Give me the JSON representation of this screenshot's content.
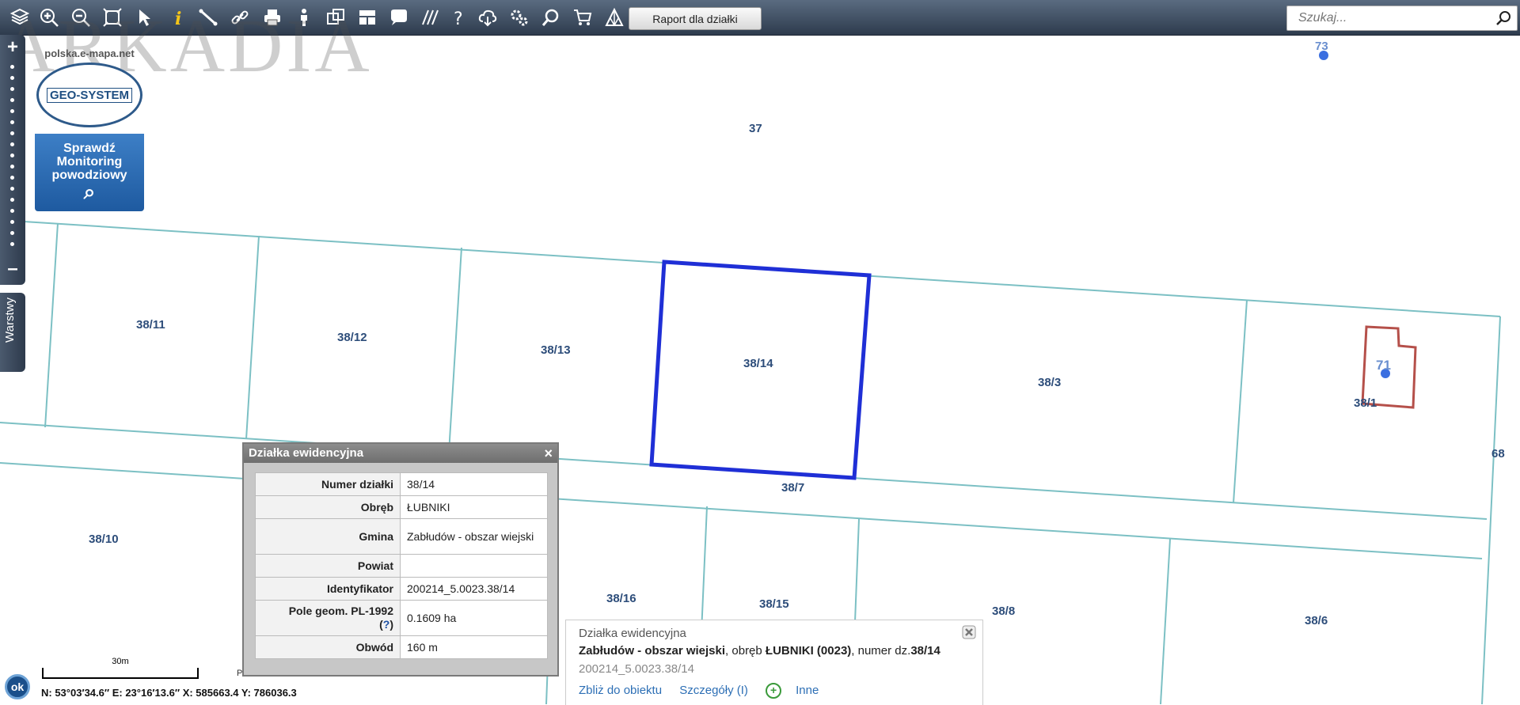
{
  "toolbar": {
    "report_button": "Raport dla działki",
    "search_placeholder": "Szukaj..."
  },
  "watermark": "ARKADIA",
  "logo": {
    "url": "polska.e-mapa.net",
    "brand": "GEO-SYSTEM",
    "line1": "Sprawdź",
    "line2": "Monitoring",
    "line3": "powodziowy"
  },
  "sidebar": {
    "layers_tab": "Warstwy"
  },
  "map_labels": {
    "p37": "37",
    "p73": "73",
    "p71": "71",
    "p68": "68",
    "p38_11": "38/11",
    "p38_12": "38/12",
    "p38_13": "38/13",
    "p38_14": "38/14",
    "p38_3": "38/3",
    "p38_1": "38/1",
    "p38_7": "38/7",
    "p38_10": "38/10",
    "p38_16": "38/16",
    "p38_15": "38/15",
    "p38_8": "38/8",
    "p38_6": "38/6"
  },
  "parcel_popup": {
    "title": "Działka ewidencyjna",
    "rows": [
      {
        "key": "Numer działki",
        "value": "38/14"
      },
      {
        "key": "Obręb",
        "value": "ŁUBNIKI"
      },
      {
        "key": "Gmina",
        "value": "Zabłudów - obszar wiejski"
      },
      {
        "key": "Powiat",
        "value": ""
      },
      {
        "key": "Identyfikator",
        "value": "200214_5.0023.38/14"
      },
      {
        "key": "Pole geom. PL-1992",
        "value": "0.1609 ha",
        "help": "?"
      },
      {
        "key": "Obwód",
        "value": "160 m"
      }
    ]
  },
  "info_panel": {
    "header": "Działka ewidencyjna",
    "gmina": "Zabłudów - obszar wiejski",
    "obreb_text": ", obręb ",
    "obreb": "ŁUBNIKI (0023)",
    "numer_text": ", numer dz.",
    "numer": "38/14",
    "identifier": "200214_5.0023.38/14",
    "link_zoom": "Zbliż do obiektu",
    "link_details": "Szczegóły (I)",
    "link_other": "Inne"
  },
  "status": {
    "ok_button": "ok",
    "scale_label": "30m",
    "coordinates": "N: 53°03′34.6″ E: 23°16′13.6″ X: 585663.4  Y: 786036.3",
    "p_fragment": "P"
  },
  "colors": {
    "parcel_line": "#7cc0c4",
    "selected_parcel": "#1f2fd6",
    "building_outline": "#b5504a",
    "label": "#2d4d7a"
  }
}
